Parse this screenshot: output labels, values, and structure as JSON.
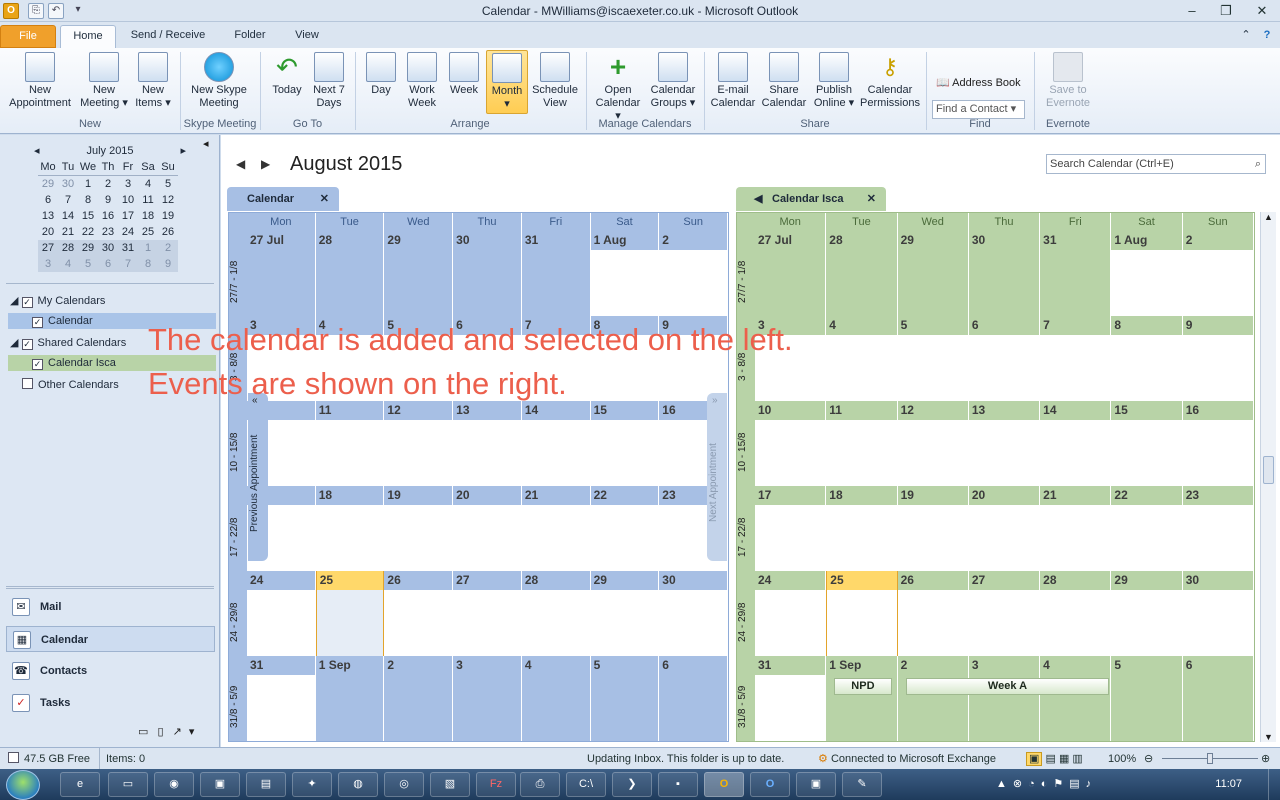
{
  "window": {
    "title": "Calendar - MWilliams@iscaexeter.co.uk - Microsoft Outlook"
  },
  "tabs": [
    {
      "label": "File"
    },
    {
      "label": "Home"
    },
    {
      "label": "Send / Receive"
    },
    {
      "label": "Folder"
    },
    {
      "label": "View"
    }
  ],
  "ribbon": {
    "new_appointment": "New\nAppointment",
    "new_meeting": "New\nMeeting ▾",
    "new_items": "New\nItems ▾",
    "new_skype": "New Skype\nMeeting",
    "today": "Today",
    "next7": "Next 7\nDays",
    "day": "Day",
    "work_week": "Work\nWeek",
    "week": "Week",
    "month": "Month",
    "schedule_view": "Schedule\nView",
    "open_calendar": "Open\nCalendar ▾",
    "calendar_groups": "Calendar\nGroups ▾",
    "email_calendar": "E-mail\nCalendar",
    "share_calendar": "Share\nCalendar",
    "publish_online": "Publish\nOnline ▾",
    "calendar_permissions": "Calendar\nPermissions",
    "find_contact": "Find a Contact",
    "address_book": "Address Book",
    "save_to_evernote": "Save to\nEvernote",
    "groups": [
      "New",
      "Skype Meeting",
      "Go To",
      "Arrange",
      "Manage Calendars",
      "Share",
      "Find",
      "Evernote"
    ]
  },
  "minical": {
    "title": "July 2015",
    "dow": [
      "Mo",
      "Tu",
      "We",
      "Th",
      "Fr",
      "Sa",
      "Su"
    ],
    "weeks": [
      [
        "29",
        "30",
        "1",
        "2",
        "3",
        "4",
        "5"
      ],
      [
        "6",
        "7",
        "8",
        "9",
        "10",
        "11",
        "12"
      ],
      [
        "13",
        "14",
        "15",
        "16",
        "17",
        "18",
        "19"
      ],
      [
        "20",
        "21",
        "22",
        "23",
        "24",
        "25",
        "26"
      ],
      [
        "27",
        "28",
        "29",
        "30",
        "31",
        "1",
        "2"
      ],
      [
        "3",
        "4",
        "5",
        "6",
        "7",
        "8",
        "9"
      ]
    ]
  },
  "tree": {
    "my_calendars": "My Calendars",
    "calendar": "Calendar",
    "shared_calendars": "Shared Calendars",
    "calendar_isca": "Calendar Isca",
    "other_calendars": "Other Calendars"
  },
  "navbuttons": {
    "mail": "Mail",
    "calendar": "Calendar",
    "contacts": "Contacts",
    "tasks": "Tasks"
  },
  "main": {
    "month_title": "August 2015",
    "search_placeholder": "Search Calendar (Ctrl+E)",
    "tab_left": "Calendar",
    "tab_right": "Calendar Isca",
    "dow": [
      "Mon",
      "Tue",
      "Wed",
      "Thu",
      "Fri",
      "Sat",
      "Sun"
    ],
    "week_labels": [
      "27/7 - 1/8",
      "3 - 8/8",
      "10 - 15/8",
      "17 - 22/8",
      "24 - 29/8",
      "31/8 - 5/9"
    ],
    "weeks": [
      [
        "27 Jul",
        "28",
        "29",
        "30",
        "31",
        "1 Aug",
        "2"
      ],
      [
        "3",
        "4",
        "5",
        "6",
        "7",
        "8",
        "9"
      ],
      [
        "10",
        "11",
        "12",
        "13",
        "14",
        "15",
        "16"
      ],
      [
        "17",
        "18",
        "19",
        "20",
        "21",
        "22",
        "23"
      ],
      [
        "24",
        "25",
        "26",
        "27",
        "28",
        "29",
        "30"
      ],
      [
        "31",
        "1 Sep",
        "2",
        "3",
        "4",
        "5",
        "6"
      ]
    ],
    "events": [
      {
        "label": "NPD"
      },
      {
        "label": "Week A"
      }
    ],
    "prev_appointment": "Previous Appointment",
    "next_appointment": "Next Appointment"
  },
  "overlay": {
    "line1": "The calendar is added and selected on the left.",
    "line2": "Events are shown on the right."
  },
  "status": {
    "free": "47.5 GB Free",
    "items": "Items: 0",
    "updating": "Updating Inbox.  This folder is up to date.",
    "connected": "Connected to Microsoft Exchange",
    "zoom": "100%"
  },
  "taskbar": {
    "time": "11:07"
  },
  "colors": {
    "left_calendar": "#a7bfe4",
    "right_calendar": "#b8d3a7",
    "today": "#ffd86a"
  }
}
